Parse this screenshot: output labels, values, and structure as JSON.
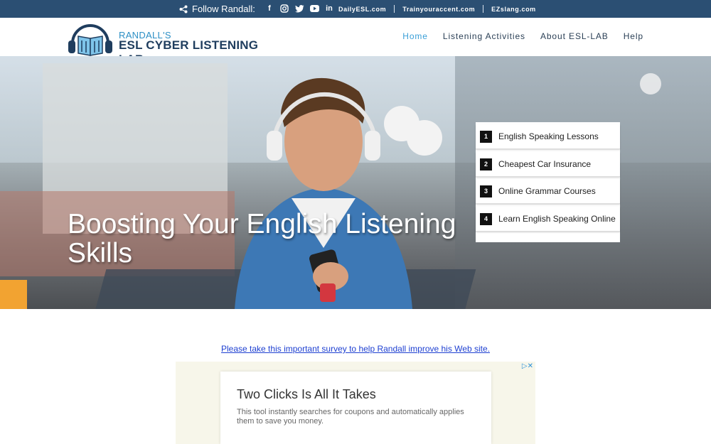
{
  "topbar": {
    "follow_label": "Follow Randall:",
    "share_icon": "share-icon",
    "social_icons": [
      "facebook-icon",
      "instagram-icon",
      "twitter-icon",
      "youtube-icon",
      "linkedin-icon"
    ],
    "links": [
      "DailyESL.com",
      "Trainyouraccent.com",
      "EZslang.com"
    ]
  },
  "header": {
    "logo_line1": "RANDALL'S",
    "logo_line2": "ESL CYBER LISTENING LAB",
    "nav": [
      {
        "label": "Home",
        "active": true
      },
      {
        "label": "Listening Activities"
      },
      {
        "label": "About ESL-LAB"
      },
      {
        "label": "Help"
      }
    ]
  },
  "hero": {
    "title": "Boosting Your English Listening Skills"
  },
  "hero_ad": {
    "items": [
      {
        "num": "1",
        "label": "English Speaking Lessons"
      },
      {
        "num": "2",
        "label": "Cheapest Car Insurance"
      },
      {
        "num": "3",
        "label": "Online Grammar Courses"
      },
      {
        "num": "4",
        "label": "Learn English Speaking Online"
      }
    ]
  },
  "main": {
    "survey_text": "Please take this important survey to help Randall improve his Web site."
  },
  "ad": {
    "title": "Two Clicks Is All It Takes",
    "text": "This tool instantly searches for coupons and automatically applies them to save you money."
  },
  "colors": {
    "topbar": "#2b4f73",
    "nav_active": "#3a9fd8",
    "link_blue": "#1d3fd1"
  }
}
